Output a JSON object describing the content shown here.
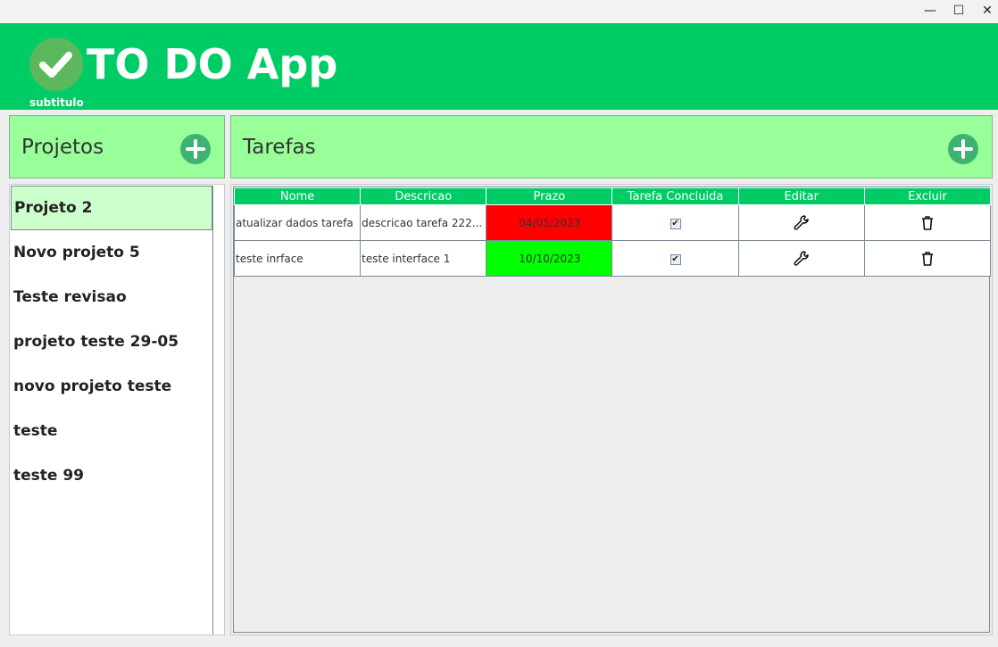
{
  "window": {
    "minimize": "—",
    "maximize": "☐",
    "close": "✕"
  },
  "header": {
    "title": "TO DO App",
    "subtitle": "subtitulo",
    "accent": "#00cc66"
  },
  "projects": {
    "title": "Projetos",
    "items": [
      {
        "label": "Projeto 2",
        "selected": true
      },
      {
        "label": "Novo projeto 5"
      },
      {
        "label": "Teste revisao"
      },
      {
        "label": "projeto teste 29-05"
      },
      {
        "label": "novo projeto teste"
      },
      {
        "label": "teste"
      },
      {
        "label": "teste 99"
      }
    ]
  },
  "tasks": {
    "title": "Tarefas",
    "columns": [
      "Nome",
      "Descricao",
      "Prazo",
      "Tarefa Concluida",
      "Editar",
      "Excluir"
    ],
    "rows": [
      {
        "nome": "atualizar dados tarefa",
        "descricao": "descricao tarefa 222...",
        "prazo": "04/05/2023",
        "prazo_color": "#ff0000",
        "concluida": true,
        "edit_icon": "wrench-icon",
        "delete_icon": "trash-icon"
      },
      {
        "nome": "teste inrface",
        "descricao": "teste interface 1",
        "prazo": "10/10/2023",
        "prazo_color": "#00ff00",
        "concluida": true,
        "edit_icon": "wrench-icon",
        "delete_icon": "trash-icon"
      }
    ]
  }
}
